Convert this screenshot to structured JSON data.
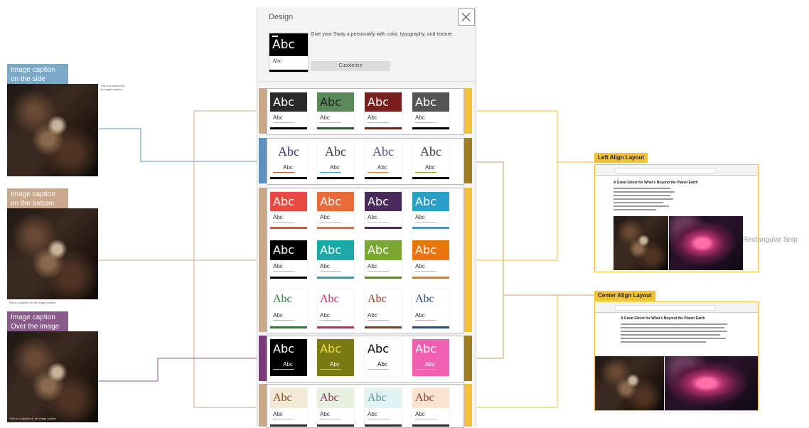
{
  "left_examples": [
    {
      "caption": "Image caption on the side",
      "color": "#7aaac8",
      "side_text": "This is a caption for an image caption"
    },
    {
      "caption": "Image caption on the bottom",
      "color": "#c9a88c",
      "bottom_text": "This is a caption for an image caption"
    },
    {
      "caption": "Image caption Over the image",
      "color": "#8a5a8a",
      "overlay_text": "This is a caption for an image caption"
    }
  ],
  "design_panel": {
    "title": "Design",
    "close_icon": "close-icon",
    "preview_large": "Abc",
    "preview_small": "Abc",
    "tagline": "Give your Sway a personality with color, typography, and texture.",
    "customize_label": "Customize"
  },
  "style_groups": [
    {
      "left_color": "#c9a88c",
      "right_color": "#f0c23a",
      "tiles": [
        {
          "head": "Abc",
          "sub": "Abc",
          "head_bg": "#2a2a2a",
          "head_color": "#ffffff",
          "bar": "#000000"
        },
        {
          "head": "Abc",
          "sub": "Abc",
          "head_bg": "#5a8a5a",
          "head_color": "#222222",
          "bar": "#2f5a2f"
        },
        {
          "head": "Abc",
          "sub": "Abc",
          "head_bg": "#7a1e1e",
          "head_color": "#ffffff",
          "bar": "#7a1e1e"
        },
        {
          "head": "Abc",
          "sub": "Abc",
          "head_bg": "#555555",
          "head_color": "#ffffff",
          "bar": "#000000"
        }
      ]
    },
    {
      "left_color": "#5b8fc0",
      "right_color": "#a07c22",
      "tiles": [
        {
          "head": "Abc",
          "sub": "Abc",
          "head_bg": "#ffffff",
          "head_color": "#2c3a7a",
          "accent": "#e0493c",
          "bar": "#000000"
        },
        {
          "head": "Abc",
          "sub": "Abc",
          "head_bg": "#ffffff",
          "head_color": "#3a3a3a",
          "accent": "#3aa8d8",
          "bar": "#000000"
        },
        {
          "head": "Abc",
          "sub": "Abc",
          "head_bg": "#ffffff",
          "head_color": "#5a4a8a",
          "accent": "#ea7a40",
          "bar": "#000000"
        },
        {
          "head": "Abc",
          "sub": "Abc",
          "head_bg": "#ffffff",
          "head_color": "#3a3a3a",
          "accent": "#7cba3a",
          "bar": "#000000"
        }
      ]
    },
    {
      "left_color": "#c9a88c",
      "right_color": "#f0c23a",
      "rows": [
        [
          {
            "head": "Abc",
            "sub": "Abc",
            "head_bg": "#e84a40",
            "head_color": "#ffffff",
            "bar": "#e84a40"
          },
          {
            "head": "Abc",
            "sub": "Abc",
            "head_bg": "#ea6a3a",
            "head_color": "#ffffff",
            "bar": "#ea6a3a"
          },
          {
            "head": "Abc",
            "sub": "Abc",
            "head_bg": "#4a2a5a",
            "head_color": "#ffffff",
            "bar": "#4a2a5a"
          },
          {
            "head": "Abc",
            "sub": "Abc",
            "head_bg": "#2aa0c8",
            "head_color": "#ffffff",
            "bar": "#2aa0c8"
          }
        ],
        [
          {
            "head": "Abc",
            "sub": "Abc",
            "head_bg": "#000000",
            "head_color": "#ffffff",
            "bar": "#000000"
          },
          {
            "head": "Abc",
            "sub": "Abc",
            "head_bg": "#1aa8a8",
            "head_color": "#ffffff",
            "bar": "#1aa8a8"
          },
          {
            "head": "Abc",
            "sub": "Abc",
            "head_bg": "#7aa830",
            "head_color": "#ffffff",
            "bar": "#5a8a20"
          },
          {
            "head": "Abc",
            "sub": "Abc",
            "head_bg": "#e8760a",
            "head_color": "#ffffff",
            "bar": "#e8760a"
          }
        ],
        [
          {
            "head": "Abc",
            "sub": "Abc",
            "head_bg": "#ffffff",
            "head_color": "#2a7a3a",
            "bar": "#2a7a3a"
          },
          {
            "head": "Abc",
            "sub": "Abc",
            "head_bg": "#ffffff",
            "head_color": "#c02a6a",
            "bar": "#c02a6a"
          },
          {
            "head": "Abc",
            "sub": "Abc",
            "head_bg": "#ffffff",
            "head_color": "#8a3a2a",
            "bar": "#8a3a2a"
          },
          {
            "head": "Abc",
            "sub": "Abc",
            "head_bg": "#ffffff",
            "head_color": "#2a4a8a",
            "bar": "#2a4a8a"
          }
        ]
      ]
    },
    {
      "left_color": "#7a3a7a",
      "right_color": "#a07c22",
      "tiles": [
        {
          "head": "Abc",
          "sub": "Abc",
          "head_bg": "#000000",
          "head_color": "#ffffff",
          "bar": "#000000"
        },
        {
          "head": "Abc",
          "sub": "Abc",
          "head_bg": "#7a7a10",
          "head_color": "#f0e040",
          "bar": "#7a7a10"
        },
        {
          "head": "Abc",
          "sub": "Abc",
          "head_bg": "#ffffff",
          "head_color": "#000000",
          "bar": "#ffffff"
        },
        {
          "head": "Abc",
          "sub": "Abc",
          "head_bg": "#f060b0",
          "head_color": "#ffffff",
          "bar": "#f060b0"
        }
      ]
    },
    {
      "left_color": "#c9a88c",
      "right_color": "#f0c23a",
      "tiles": [
        {
          "head": "Abc",
          "sub": "Abc",
          "head_bg": "#f3ead6",
          "head_color": "#8a4a2a",
          "bar": "#2a2a2a"
        },
        {
          "head": "Abc",
          "sub": "Abc",
          "head_bg": "#e8f0e0",
          "head_color": "#8a2a5a",
          "bar": "#2a2a2a"
        },
        {
          "head": "Abc",
          "sub": "Abc",
          "head_bg": "#e0f4f4",
          "head_color": "#5a8aa0",
          "bar": "#2a2a2a"
        },
        {
          "head": "Abc",
          "sub": "Abc",
          "head_bg": "#fbe4d0",
          "head_color": "#8a3a2a",
          "bar": "#2a2a2a"
        }
      ]
    }
  ],
  "right_examples": [
    {
      "label": "Left Align Layout",
      "article_title": "A Great Ghost for What's Beyond the Planet Earth"
    },
    {
      "label": "Center Align Layout",
      "article_title": "A Great Ghost for What's Beyond the Planet Earth"
    }
  ],
  "snip_label": "Rectangular Snip"
}
